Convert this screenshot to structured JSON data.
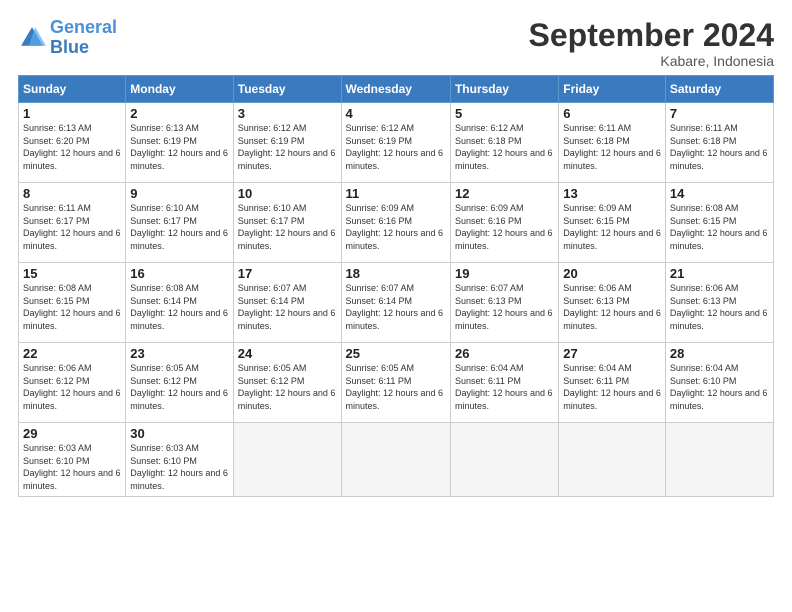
{
  "logo": {
    "general": "General",
    "blue": "Blue"
  },
  "title": "September 2024",
  "subtitle": "Kabare, Indonesia",
  "days_header": [
    "Sunday",
    "Monday",
    "Tuesday",
    "Wednesday",
    "Thursday",
    "Friday",
    "Saturday"
  ],
  "weeks": [
    [
      {
        "day": "1",
        "sunrise": "6:13 AM",
        "sunset": "6:20 PM",
        "daylight": "12 hours and 6 minutes."
      },
      {
        "day": "2",
        "sunrise": "6:13 AM",
        "sunset": "6:19 PM",
        "daylight": "12 hours and 6 minutes."
      },
      {
        "day": "3",
        "sunrise": "6:12 AM",
        "sunset": "6:19 PM",
        "daylight": "12 hours and 6 minutes."
      },
      {
        "day": "4",
        "sunrise": "6:12 AM",
        "sunset": "6:19 PM",
        "daylight": "12 hours and 6 minutes."
      },
      {
        "day": "5",
        "sunrise": "6:12 AM",
        "sunset": "6:18 PM",
        "daylight": "12 hours and 6 minutes."
      },
      {
        "day": "6",
        "sunrise": "6:11 AM",
        "sunset": "6:18 PM",
        "daylight": "12 hours and 6 minutes."
      },
      {
        "day": "7",
        "sunrise": "6:11 AM",
        "sunset": "6:18 PM",
        "daylight": "12 hours and 6 minutes."
      }
    ],
    [
      {
        "day": "8",
        "sunrise": "6:11 AM",
        "sunset": "6:17 PM",
        "daylight": "12 hours and 6 minutes."
      },
      {
        "day": "9",
        "sunrise": "6:10 AM",
        "sunset": "6:17 PM",
        "daylight": "12 hours and 6 minutes."
      },
      {
        "day": "10",
        "sunrise": "6:10 AM",
        "sunset": "6:17 PM",
        "daylight": "12 hours and 6 minutes."
      },
      {
        "day": "11",
        "sunrise": "6:09 AM",
        "sunset": "6:16 PM",
        "daylight": "12 hours and 6 minutes."
      },
      {
        "day": "12",
        "sunrise": "6:09 AM",
        "sunset": "6:16 PM",
        "daylight": "12 hours and 6 minutes."
      },
      {
        "day": "13",
        "sunrise": "6:09 AM",
        "sunset": "6:15 PM",
        "daylight": "12 hours and 6 minutes."
      },
      {
        "day": "14",
        "sunrise": "6:08 AM",
        "sunset": "6:15 PM",
        "daylight": "12 hours and 6 minutes."
      }
    ],
    [
      {
        "day": "15",
        "sunrise": "6:08 AM",
        "sunset": "6:15 PM",
        "daylight": "12 hours and 6 minutes."
      },
      {
        "day": "16",
        "sunrise": "6:08 AM",
        "sunset": "6:14 PM",
        "daylight": "12 hours and 6 minutes."
      },
      {
        "day": "17",
        "sunrise": "6:07 AM",
        "sunset": "6:14 PM",
        "daylight": "12 hours and 6 minutes."
      },
      {
        "day": "18",
        "sunrise": "6:07 AM",
        "sunset": "6:14 PM",
        "daylight": "12 hours and 6 minutes."
      },
      {
        "day": "19",
        "sunrise": "6:07 AM",
        "sunset": "6:13 PM",
        "daylight": "12 hours and 6 minutes."
      },
      {
        "day": "20",
        "sunrise": "6:06 AM",
        "sunset": "6:13 PM",
        "daylight": "12 hours and 6 minutes."
      },
      {
        "day": "21",
        "sunrise": "6:06 AM",
        "sunset": "6:13 PM",
        "daylight": "12 hours and 6 minutes."
      }
    ],
    [
      {
        "day": "22",
        "sunrise": "6:06 AM",
        "sunset": "6:12 PM",
        "daylight": "12 hours and 6 minutes."
      },
      {
        "day": "23",
        "sunrise": "6:05 AM",
        "sunset": "6:12 PM",
        "daylight": "12 hours and 6 minutes."
      },
      {
        "day": "24",
        "sunrise": "6:05 AM",
        "sunset": "6:12 PM",
        "daylight": "12 hours and 6 minutes."
      },
      {
        "day": "25",
        "sunrise": "6:05 AM",
        "sunset": "6:11 PM",
        "daylight": "12 hours and 6 minutes."
      },
      {
        "day": "26",
        "sunrise": "6:04 AM",
        "sunset": "6:11 PM",
        "daylight": "12 hours and 6 minutes."
      },
      {
        "day": "27",
        "sunrise": "6:04 AM",
        "sunset": "6:11 PM",
        "daylight": "12 hours and 6 minutes."
      },
      {
        "day": "28",
        "sunrise": "6:04 AM",
        "sunset": "6:10 PM",
        "daylight": "12 hours and 6 minutes."
      }
    ],
    [
      {
        "day": "29",
        "sunrise": "6:03 AM",
        "sunset": "6:10 PM",
        "daylight": "12 hours and 6 minutes."
      },
      {
        "day": "30",
        "sunrise": "6:03 AM",
        "sunset": "6:10 PM",
        "daylight": "12 hours and 6 minutes."
      },
      null,
      null,
      null,
      null,
      null
    ]
  ]
}
